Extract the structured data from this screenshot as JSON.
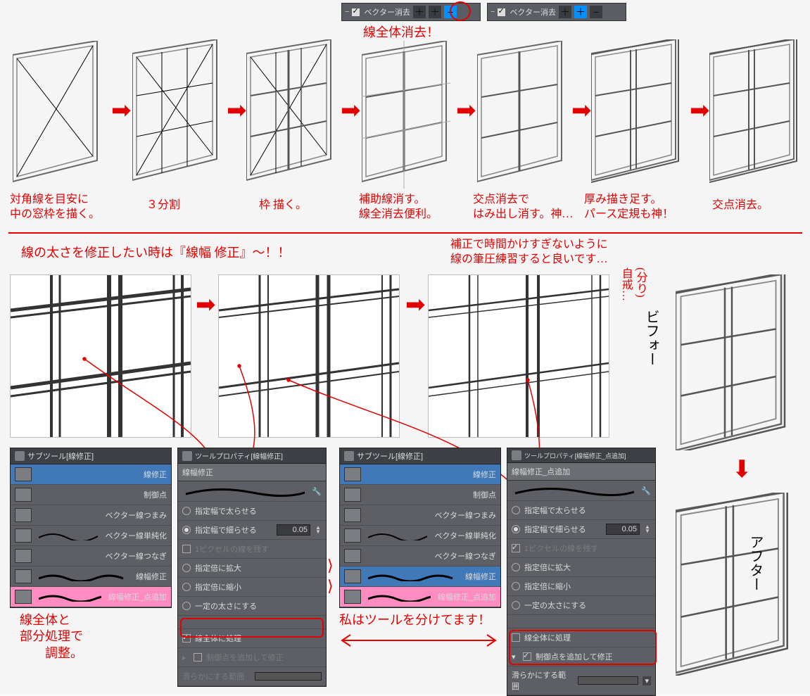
{
  "toolbar": {
    "vector_erase_label": "ベクター消去",
    "btn_plus": "＋",
    "btn_plus2": "＋",
    "btn_minus": "−"
  },
  "top_captions": {
    "erase_whole": "線全体消去！",
    "step1": "対角線を目安に\n中の窓枠を描く。",
    "step2": "３分割",
    "step3": "枠 描く。",
    "step4": "補助線消す。\n線全消去便利。",
    "step5": "交点消去で\nはみ出し消す。神…",
    "step6": "厚み描き足す。\nパース定規も神！",
    "step7": "交点消去。"
  },
  "mid_text": {
    "line_width_fix": "線の太さを修正したい時は『線幅 修正』〜！！",
    "practice_note": "補正で時間かけすぎないように\n線の筆圧練習すると良いです…",
    "self_note": "(分り)\n自戒…",
    "before_label": "ビフォー",
    "after_label": "アフター"
  },
  "bottom_text": {
    "whole_partial": "線全体と\n部分処理で\n　　調整。",
    "split_tools": "私はツールを分けてます！"
  },
  "subtool_panel": {
    "title": "サブツール[線修正]",
    "group": "線修正",
    "items": [
      {
        "label": "制御点"
      },
      {
        "label": "ベクター線つまみ"
      },
      {
        "label": "ベクター線単純化"
      },
      {
        "label": "ベクター線つなぎ"
      },
      {
        "label": "線幅修正"
      },
      {
        "label": "線幅修正_点追加"
      }
    ]
  },
  "prop_panel_a": {
    "title": "ツールプロパティ[線幅修正]",
    "header": "線幅修正",
    "opts": {
      "thicken": "指定幅で太らせる",
      "thin": "指定幅で細らせる",
      "thin_value": "0.05",
      "keep1px": "1ピクセルの線を残す",
      "scale_up": "指定倍に拡大",
      "scale_down": "指定倍に縮小",
      "to_fixed": "一定の太さにする",
      "whole_line": "線全体に処理",
      "add_cp_fix": "制御点を追加して修正",
      "smooth_range": "滑らかにする範囲"
    }
  },
  "prop_panel_b": {
    "title": "ツールプロパティ[線幅修正_点追加]",
    "header": "線幅修正_点追加"
  }
}
